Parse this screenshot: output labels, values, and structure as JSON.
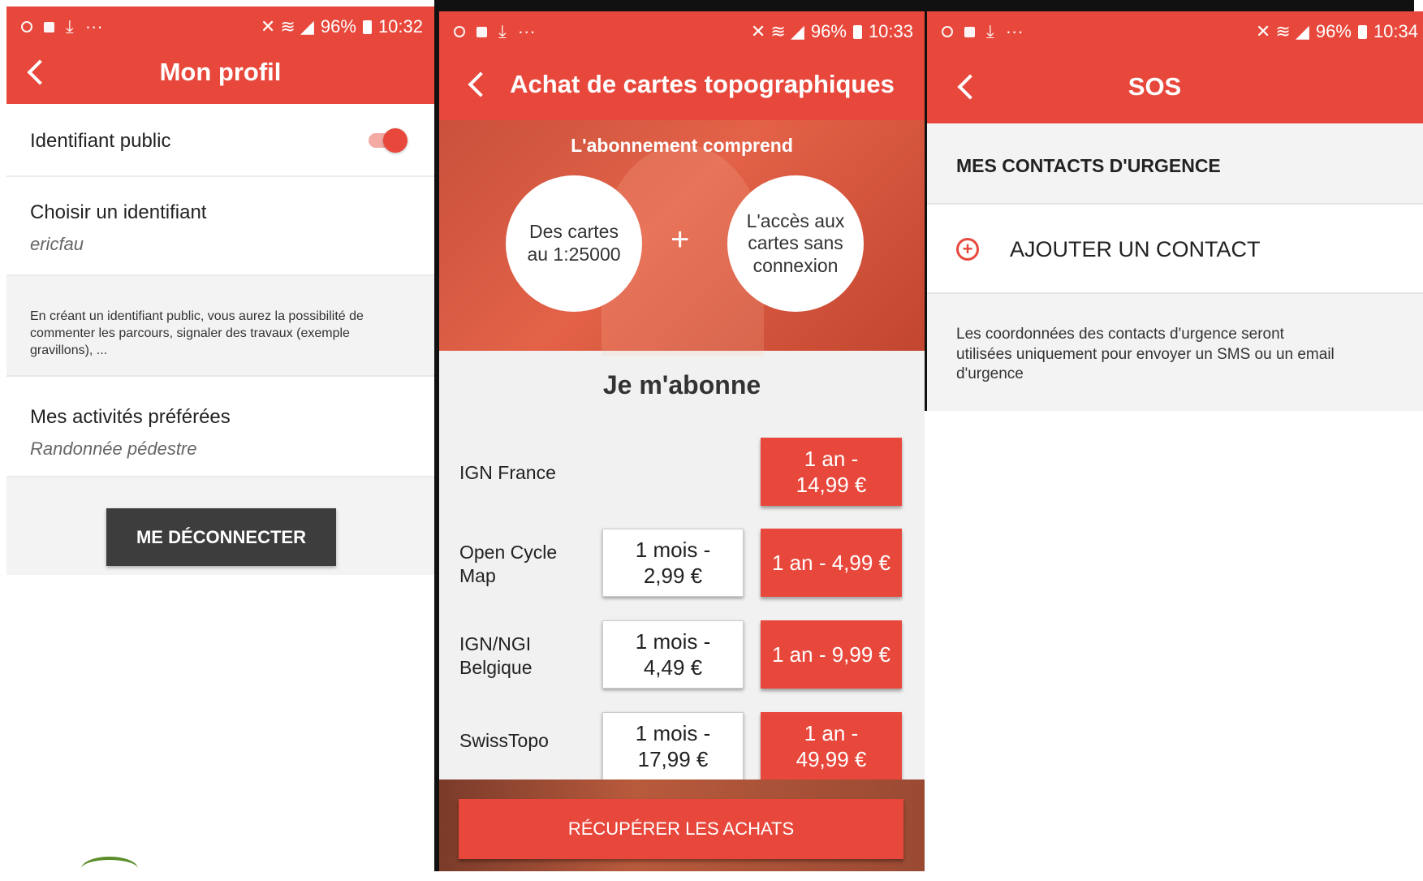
{
  "status_bars": [
    {
      "battery": "96%",
      "time": "10:32"
    },
    {
      "battery": "96%",
      "time": "10:33"
    },
    {
      "battery": "96%",
      "time": "10:34"
    }
  ],
  "profile": {
    "title": "Mon profil",
    "public_id_label": "Identifiant public",
    "choose_id_label": "Choisir un identifiant",
    "choose_id_value": "ericfau",
    "info_text": "En créant un identifiant public, vous aurez la possibilité de commenter les parcours, signaler des travaux (exemple gravillons), ...",
    "activities_label": "Mes activités préférées",
    "activities_value": "Randonnée pédestre",
    "logout_label": "ME DÉCONNECTER"
  },
  "maps": {
    "title": "Achat de cartes topographiques",
    "banner_title": "L'abonnement comprend",
    "feature_1": "Des cartes au 1:25000",
    "plus": "+",
    "feature_2": "L'accès aux cartes sans connexion",
    "subscribe_heading": "Je m'abonne",
    "products": [
      {
        "name": "IGN France",
        "year": "1 an - 14,99 €"
      },
      {
        "name": "Open Cycle Map",
        "month": "1 mois - 2,99 €",
        "year": "1 an - 4,99 €"
      },
      {
        "name": "IGN/NGI Belgique",
        "month": "1 mois - 4,49 €",
        "year": "1 an - 9,99 €"
      },
      {
        "name": "SwissTopo",
        "month": "1 mois - 17,99 €",
        "year": "1 an - 49,99 €"
      }
    ],
    "restore_label": "RÉCUPÉRER LES ACHATS"
  },
  "sos": {
    "title": "SOS",
    "section_header": "MES CONTACTS D'URGENCE",
    "add_contact_label": "AJOUTER UN CONTACT",
    "info_text": "Les coordonnées des contacts d'urgence seront utilisées uniquement pour envoyer un SMS ou un email d'urgence"
  },
  "colors": {
    "accent": "#e8483c",
    "dark_button": "#3d3d3d"
  }
}
